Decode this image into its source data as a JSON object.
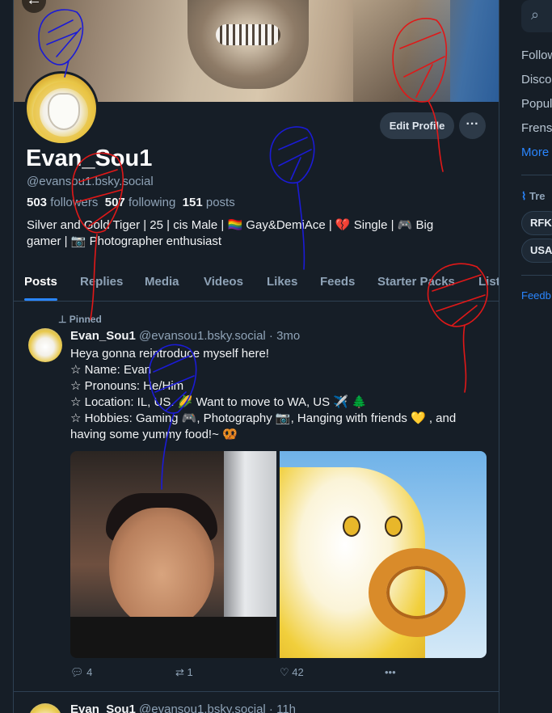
{
  "profile": {
    "display_name": "Evan_Sou1",
    "handle": "@evansou1.bsky.social",
    "followers_count": "503",
    "followers_label": "followers",
    "following_count": "507",
    "following_label": "following",
    "posts_count": "151",
    "posts_label": "posts",
    "bio_line1": "Silver and Gold Tiger | 25 | cis Male | 🏳️‍🌈 Gay&DemiAce | 💔 Single | 🎮 Big",
    "bio_line2": "gamer | 📷 Photographer enthusiast",
    "edit_button": "Edit Profile",
    "more_button": "···",
    "back_icon": "←"
  },
  "tabs": [
    "Posts",
    "Replies",
    "Media",
    "Videos",
    "Likes",
    "Feeds",
    "Starter Packs",
    "List"
  ],
  "active_tab": "Posts",
  "pinned_post": {
    "pinned_label": "Pinned",
    "author": "Evan_Sou1",
    "handle": "@evansou1.bsky.social",
    "time": "· 3mo",
    "lines": [
      "Heya gonna reintroduce myself here!",
      "☆ Name: Evan",
      "☆ Pronouns: He/Him",
      "☆ Location: IL, US. 🌽 Want to move to WA, US ✈️ 🌲",
      "☆ Hobbies: Gaming 🎮, Photography 📷, Hanging with friends 💛 , and",
      "having some yummy food!~ 🥨"
    ],
    "replies": "4",
    "reposts": "1",
    "likes": "42",
    "more": "•••"
  },
  "next_post": {
    "author": "Evan_Sou1",
    "handle": "@evansou1.bsky.social",
    "time": "· 11h"
  },
  "right_rail": {
    "links": [
      "Follow",
      "Disco",
      "Popul",
      "Frens"
    ],
    "more_label": "More",
    "trending_label": "Tre",
    "pills": [
      "RFK",
      "USA"
    ],
    "feedback": "Feedb"
  },
  "colors": {
    "background": "#161e27",
    "accent": "#2a86ff",
    "muted_text": "#8fa3b7",
    "button_bg": "#2d3a48"
  }
}
